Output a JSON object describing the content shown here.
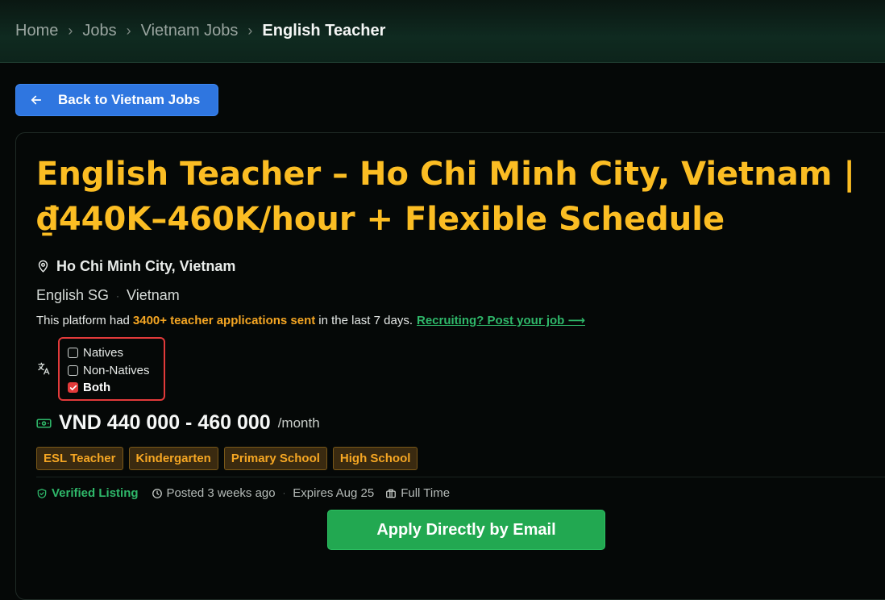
{
  "breadcrumb": {
    "items": [
      "Home",
      "Jobs",
      "Vietnam Jobs"
    ],
    "current": "English Teacher"
  },
  "back_button": {
    "label": "Back to Vietnam Jobs"
  },
  "job": {
    "title": "English Teacher – Ho Chi Minh City, Vietnam | ₫440K–460K/hour + Flexible Schedule",
    "location": "Ho Chi Minh City, Vietnam",
    "company": "English SG",
    "country": "Vietnam",
    "stats": {
      "prefix": "This platform had",
      "highlight": "3400+ teacher applications sent",
      "suffix": "in the last 7 days.",
      "link": "Recruiting? Post your job ⟶"
    },
    "language_options": [
      {
        "label": "Natives",
        "checked": false
      },
      {
        "label": "Non-Natives",
        "checked": false
      },
      {
        "label": "Both",
        "checked": true
      }
    ],
    "salary": {
      "amount": "VND 440 000 - 460 000",
      "unit": "/month"
    },
    "tags": [
      "ESL Teacher",
      "Kindergarten",
      "Primary School",
      "High School"
    ],
    "meta": {
      "verified": "Verified Listing",
      "posted": "Posted 3 weeks ago",
      "expires": "Expires Aug 25",
      "type": "Full Time"
    },
    "apply_label": "Apply Directly by Email"
  },
  "colors": {
    "title": "#fbbd23",
    "accent_green": "#22a851",
    "back_blue": "#2f76e0",
    "tag_text": "#f5a623",
    "highlight_red": "#e23a3a"
  },
  "icons": [
    "chevron-right-icon",
    "arrow-left-icon",
    "map-pin-icon",
    "translate-icon",
    "money-icon",
    "shield-check-icon",
    "clock-icon",
    "briefcase-icon"
  ]
}
